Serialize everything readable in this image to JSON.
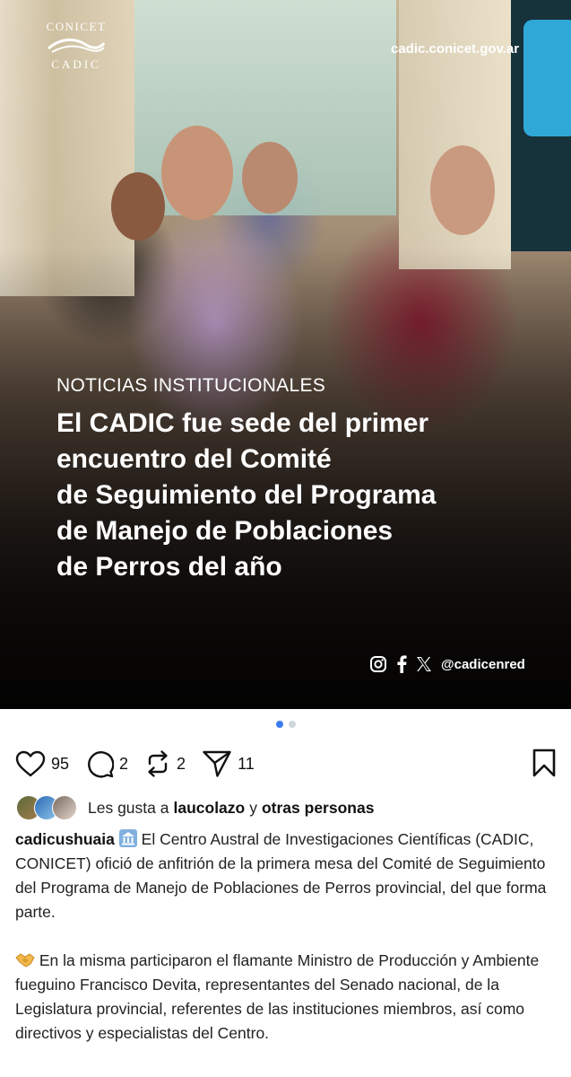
{
  "image": {
    "logo_top": "CONICET",
    "logo_bottom": "CADIC",
    "site_url": "cadic.conicet.gov.ar",
    "category": "NOTICIAS INSTITUCIONALES",
    "headline_lines": [
      "El CADIC fue sede del primer",
      "encuentro del Comité",
      "de Seguimiento del Programa",
      "de Manejo de Poblaciones",
      "de Perros del año"
    ],
    "social_handle": "@cadicenred",
    "social_icons": [
      "instagram-icon",
      "facebook-icon",
      "x-icon"
    ]
  },
  "carousel": {
    "total": 2,
    "active": 0
  },
  "actions": {
    "likes": "95",
    "comments": "2",
    "reposts": "2",
    "shares": "11"
  },
  "liked_by": {
    "prefix": "Les gusta a",
    "user": "laucolazo",
    "joiner": "y",
    "others": "otras personas"
  },
  "caption": {
    "username": "cadicushuaia",
    "paragraph1": "El Centro Austral de Investigaciones Científicas (CADIC, CONICET) ofició de anfitrión de la primera mesa del Comité de Seguimiento del Programa de Manejo de Poblaciones de Perros provincial, del que forma parte.",
    "paragraph2": "En la misma participaron el flamante Ministro de Producción y Ambiente fueguino Francisco Devita, representantes del Senado nacional, de la Legislatura provincial, referentes de las instituciones miembros, así como directivos y especialistas del Centro."
  },
  "colors": {
    "accent_dot": "#3d7cf0",
    "inactive_dot": "#cfd6dc"
  }
}
